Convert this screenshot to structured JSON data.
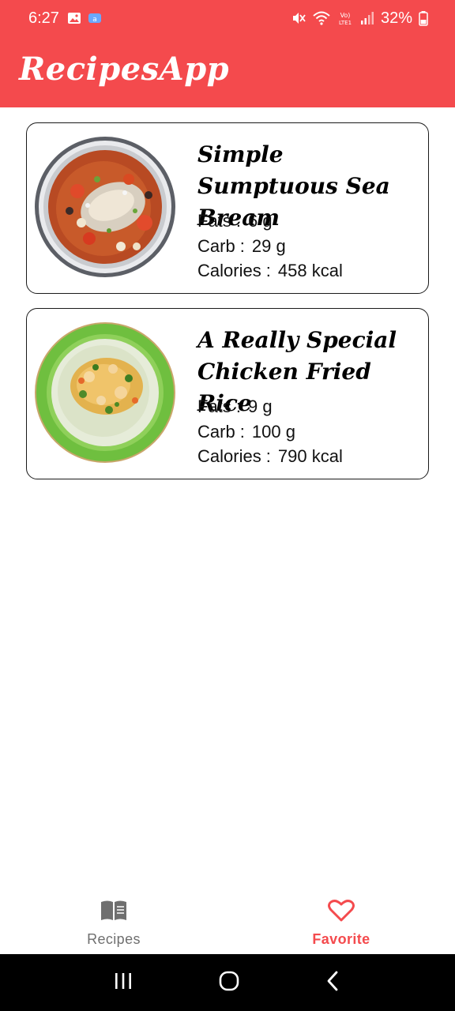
{
  "status_bar": {
    "time": "6:27",
    "battery": "32%",
    "icons": [
      "gallery-icon",
      "app-icon",
      "mute-icon",
      "wifi-icon",
      "volte-icon",
      "signal-icon",
      "battery-icon"
    ]
  },
  "app_bar": {
    "title": "RecipesApp",
    "color": "#f44a4d"
  },
  "recipes": [
    {
      "title": "Simple Sumptuous Sea Bream",
      "fats_label": "Fats :",
      "fats_value": "6 g",
      "carb_label": "Carb :",
      "carb_value": "29 g",
      "calories_label": "Calories :",
      "calories_value": "458 kcal"
    },
    {
      "title": "A Really Special Chicken Fried Rice",
      "fats_label": "Fats :",
      "fats_value": "9 g",
      "carb_label": "Carb :",
      "carb_value": "100 g",
      "calories_label": "Calories :",
      "calories_value": "790 kcal"
    }
  ],
  "bottom_nav": {
    "items": [
      {
        "label": "Recipes",
        "icon": "book-icon",
        "active": false
      },
      {
        "label": "Favorite",
        "icon": "heart-icon",
        "active": true
      }
    ]
  },
  "system_nav": {
    "icons": [
      "recents-icon",
      "home-icon",
      "back-icon"
    ]
  }
}
